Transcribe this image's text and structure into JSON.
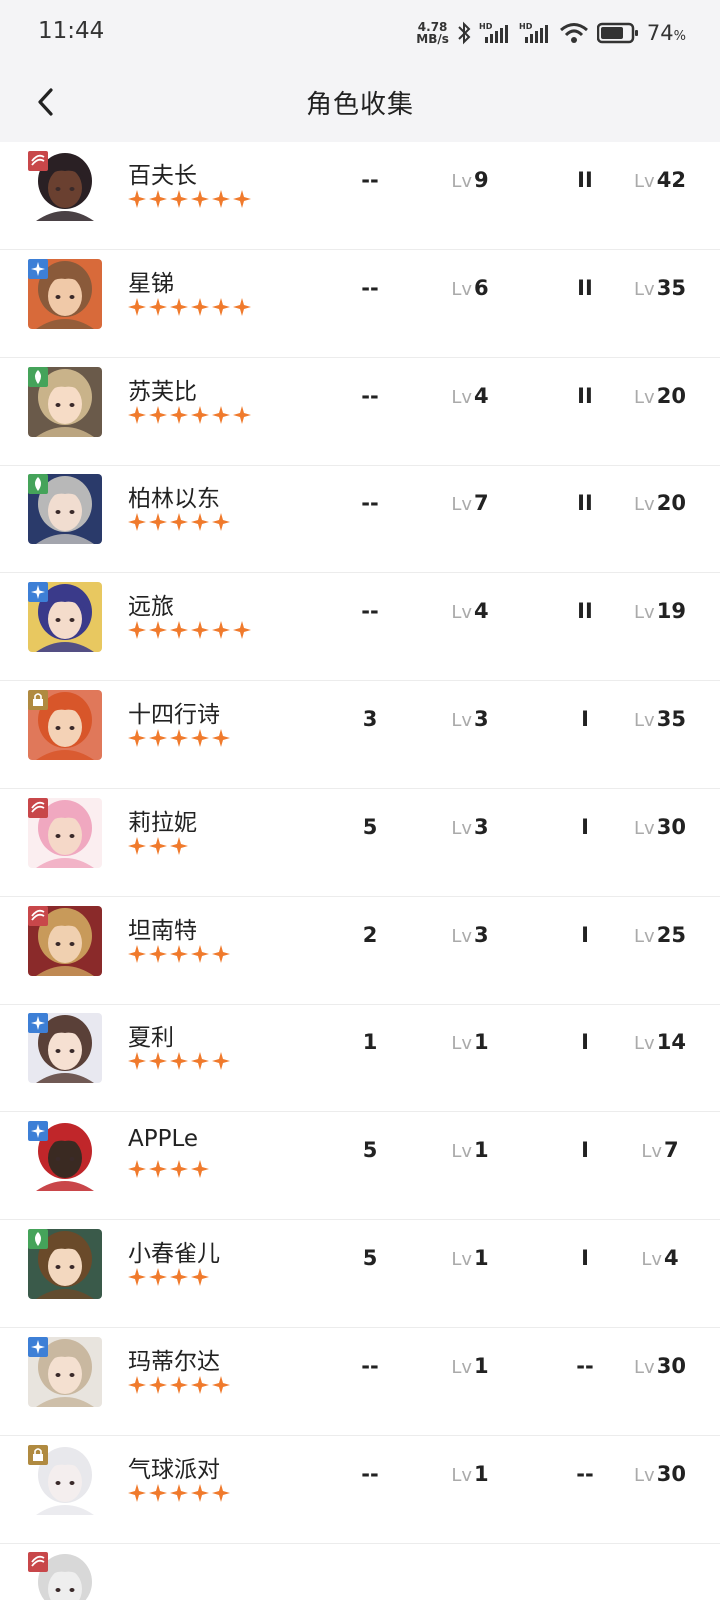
{
  "status_bar": {
    "time": "11:44",
    "net_speed_value": "4.78",
    "net_speed_unit": "MB/s",
    "battery_value": "74",
    "battery_unit": "%"
  },
  "header": {
    "title": "角色收集",
    "back_icon": "chevron-left-icon"
  },
  "level_prefix": "Lv",
  "colors": {
    "star": "#f07a2c",
    "class_red": "#c8474a",
    "class_blue": "#3d7fd6",
    "class_green": "#45a35a",
    "class_gold": "#b08a40"
  },
  "rows": [
    {
      "name": "百夫长",
      "stars": 6,
      "class_icon": "wave-icon",
      "class_color": "#c8474a",
      "col_a": "--",
      "level_1": "9",
      "col_c": "II",
      "level_2": "42",
      "hair": "#2a2024",
      "skin": "#6a4030",
      "bg": "#ffffff"
    },
    {
      "name": "星锑",
      "stars": 6,
      "class_icon": "star-rune-icon",
      "class_color": "#3d7fd6",
      "col_a": "--",
      "level_1": "6",
      "col_c": "II",
      "level_2": "35",
      "hair": "#8a5a3a",
      "skin": "#f0c9a8",
      "bg": "#d86a3a"
    },
    {
      "name": "苏芙比",
      "stars": 6,
      "class_icon": "leaf-icon",
      "class_color": "#45a35a",
      "col_a": "--",
      "level_1": "4",
      "col_c": "II",
      "level_2": "20",
      "hair": "#c9b38a",
      "skin": "#f6dcc6",
      "bg": "#6a5a4a"
    },
    {
      "name": "柏林以东",
      "stars": 5,
      "class_icon": "leaf-icon",
      "class_color": "#45a35a",
      "col_a": "--",
      "level_1": "7",
      "col_c": "II",
      "level_2": "20",
      "hair": "#b8b8b8",
      "skin": "#f1ddd0",
      "bg": "#2a3a6a"
    },
    {
      "name": "远旅",
      "stars": 6,
      "class_icon": "star-rune-icon",
      "class_color": "#3d7fd6",
      "col_a": "--",
      "level_1": "4",
      "col_c": "II",
      "level_2": "19",
      "hair": "#3a3a8a",
      "skin": "#f4dccb",
      "bg": "#e8c860"
    },
    {
      "name": "十四行诗",
      "stars": 5,
      "class_icon": "lock-beast-icon",
      "class_color": "#b08a40",
      "col_a": "3",
      "level_1": "3",
      "col_c": "I",
      "level_2": "35",
      "hair": "#d8562a",
      "skin": "#f4d2b6",
      "bg": "#e0785a"
    },
    {
      "name": "莉拉妮",
      "stars": 3,
      "class_icon": "wave-icon",
      "class_color": "#c8474a",
      "col_a": "5",
      "level_1": "3",
      "col_c": "I",
      "level_2": "30",
      "hair": "#f0a8c0",
      "skin": "#f5d8c8",
      "bg": "#fbeef0"
    },
    {
      "name": "坦南特",
      "stars": 5,
      "class_icon": "wave-icon",
      "class_color": "#c8474a",
      "col_a": "2",
      "level_1": "3",
      "col_c": "I",
      "level_2": "25",
      "hair": "#c89a5a",
      "skin": "#f0d0b0",
      "bg": "#8a2a2a"
    },
    {
      "name": "夏利",
      "stars": 5,
      "class_icon": "star-rune-icon",
      "class_color": "#3d7fd6",
      "col_a": "1",
      "level_1": "1",
      "col_c": "I",
      "level_2": "14",
      "hair": "#5a4038",
      "skin": "#f6e0d2",
      "bg": "#e8e8f0"
    },
    {
      "name": "APPLe",
      "stars": 4,
      "class_icon": "star-rune-icon",
      "class_color": "#3d7fd6",
      "col_a": "5",
      "level_1": "1",
      "col_c": "I",
      "level_2": "7",
      "hair": "#c0262a",
      "skin": "#3a2a22",
      "bg": "#ffffff"
    },
    {
      "name": "小春雀儿",
      "stars": 4,
      "class_icon": "leaf-icon",
      "class_color": "#45a35a",
      "col_a": "5",
      "level_1": "1",
      "col_c": "I",
      "level_2": "4",
      "hair": "#6a4a2a",
      "skin": "#f3d8bf",
      "bg": "#3a5a4a"
    },
    {
      "name": "玛蒂尔达",
      "stars": 5,
      "class_icon": "star-rune-icon",
      "class_color": "#3d7fd6",
      "col_a": "--",
      "level_1": "1",
      "col_c": "--",
      "level_2": "30",
      "hair": "#c9b8a0",
      "skin": "#f4e0d0",
      "bg": "#e8e4de"
    },
    {
      "name": "气球派对",
      "stars": 5,
      "class_icon": "lock-beast-icon",
      "class_color": "#b08a40",
      "col_a": "--",
      "level_1": "1",
      "col_c": "--",
      "level_2": "30",
      "hair": "#e8e8ec",
      "skin": "#f4eeee",
      "bg": "#ffffff"
    },
    {
      "name": "",
      "stars": 0,
      "class_icon": "wave-icon",
      "class_color": "#c8474a",
      "col_a": "",
      "level_1": "",
      "col_c": "",
      "level_2": "",
      "hair": "#d8d8d8",
      "skin": "#eeeeee",
      "bg": "#ffffff"
    }
  ]
}
